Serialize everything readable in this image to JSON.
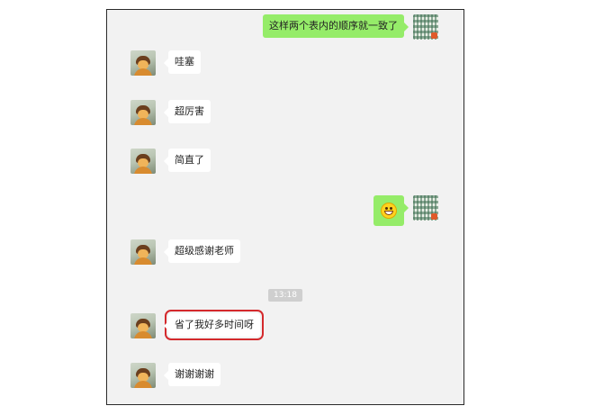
{
  "messages": [
    {
      "side": "right",
      "text": "这样两个表内的顺序就一致了"
    },
    {
      "side": "left",
      "text": "哇塞"
    },
    {
      "side": "left",
      "text": "超厉害"
    },
    {
      "side": "left",
      "text": "简直了"
    },
    {
      "side": "right",
      "emoji": "grinning-face-emoji"
    },
    {
      "side": "left",
      "text": "超级感谢老师"
    },
    {
      "side": "left",
      "text": "省了我好多时间呀",
      "highlighted": true
    },
    {
      "side": "left",
      "text": "谢谢谢谢"
    }
  ],
  "timestamp": "13:18",
  "colors": {
    "chat_background": "#f2f2f2",
    "outgoing_bubble": "#95ec69",
    "incoming_bubble": "#ffffff",
    "highlight_box": "#d4292c"
  }
}
